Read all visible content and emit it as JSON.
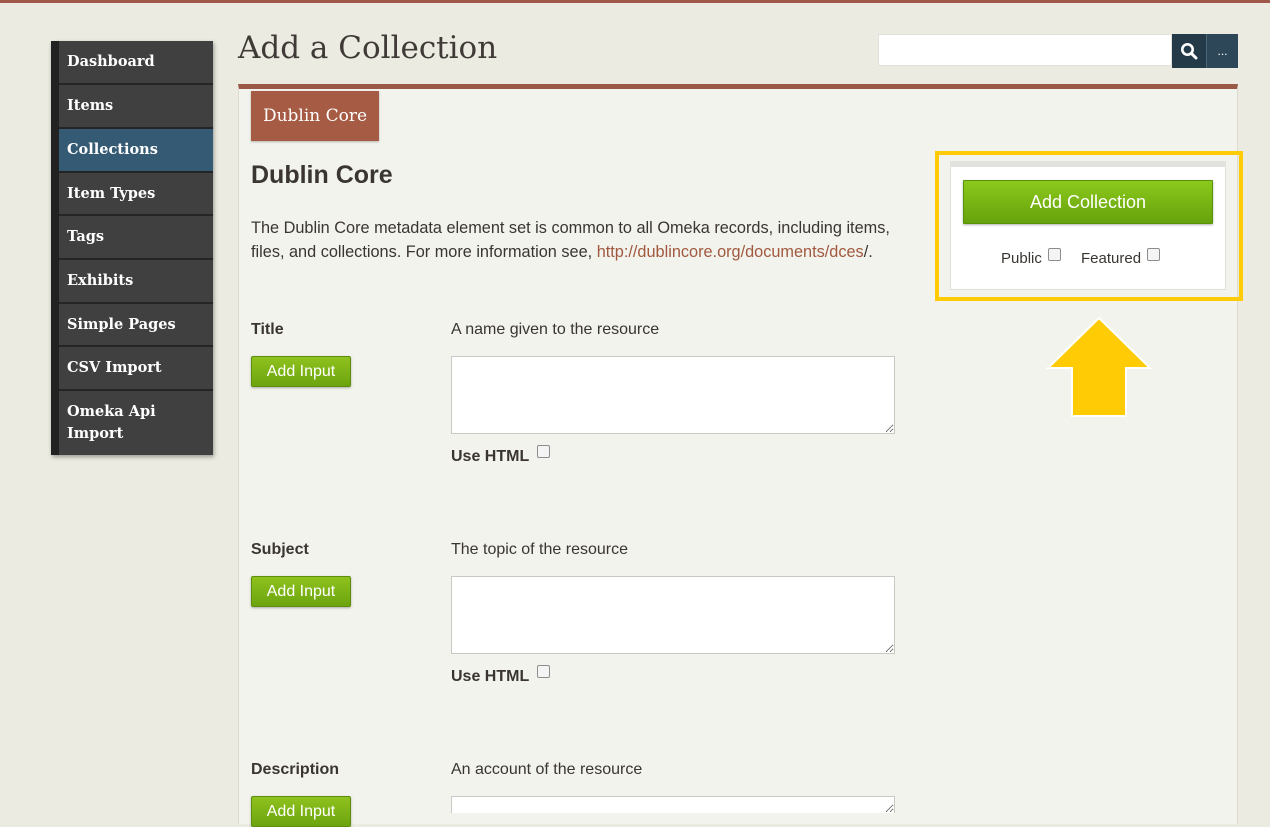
{
  "sidebar": {
    "items": [
      {
        "label": "Dashboard"
      },
      {
        "label": "Items"
      },
      {
        "label": "Collections"
      },
      {
        "label": "Item Types"
      },
      {
        "label": "Tags"
      },
      {
        "label": "Exhibits"
      },
      {
        "label": "Simple Pages"
      },
      {
        "label": "CSV Import"
      },
      {
        "label": "Omeka Api Import"
      }
    ],
    "active": "Collections"
  },
  "header": {
    "title": "Add a Collection",
    "search": {
      "value": "",
      "placeholder": "",
      "advanced_label": "..."
    }
  },
  "tabs": [
    {
      "label": "Dublin Core"
    }
  ],
  "section": {
    "title": "Dublin Core",
    "intro_text": "The Dublin Core metadata element set is common to all Omeka records, including items, files, and collections. For more information see,",
    "intro_link": "http://dublincore.org/documents/dces",
    "intro_end": "/."
  },
  "fields": [
    {
      "label": "Title",
      "description": "A name given to the resource",
      "add_input": "Add Input",
      "use_html": "Use HTML"
    },
    {
      "label": "Subject",
      "description": "The topic of the resource",
      "add_input": "Add Input",
      "use_html": "Use HTML"
    },
    {
      "label": "Description",
      "description": "An account of the resource",
      "add_input": "Add Input"
    }
  ],
  "save_panel": {
    "add_button": "Add Collection",
    "public_label": "Public",
    "featured_label": "Featured"
  },
  "colors": {
    "accent": "#a65b44",
    "nav_active": "#355a73",
    "button_green": "#7ab515",
    "highlight": "#ffcb05"
  },
  "icons": {
    "search": "search-icon",
    "arrow": "arrow-up-icon"
  }
}
